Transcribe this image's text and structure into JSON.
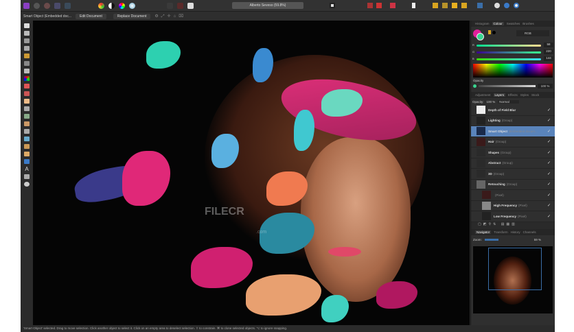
{
  "window": {
    "title": "Alberto Seveso (59.8%)"
  },
  "context_bar": {
    "selection": "Smart Object (Embedded doc...",
    "edit_document": "Edit Document",
    "replace_document": "Replace Document"
  },
  "colour_panel": {
    "tabs": [
      "Histogram",
      "Colour",
      "Swatches",
      "Brushes"
    ],
    "active_tab": "Colour",
    "mode": "RGB",
    "r_label": "R",
    "g_label": "G",
    "b_label": "B",
    "r": "58",
    "g": "220",
    "b": "144",
    "opacity_label": "Opacity",
    "opacity": "100 %",
    "fill_color": "#3ad690",
    "stroke_color": "#e0219a"
  },
  "layers_panel": {
    "tabs": [
      "Adjustment",
      "Layers",
      "Effects",
      "Styles",
      "Stock"
    ],
    "active_tab": "Layers",
    "opacity_label": "Opacity:",
    "opacity": "100 %",
    "blend_mode": "Normal",
    "layers": [
      {
        "name": "Depth of Field Blur",
        "type": "",
        "selected": false
      },
      {
        "name": "Lighting",
        "type": "(Group)",
        "selected": false
      },
      {
        "name": "Smart Object",
        "type": "(Embedded docum...",
        "selected": true
      },
      {
        "name": "Hair",
        "type": "(Group)",
        "selected": false
      },
      {
        "name": "Shapes",
        "type": "(Group)",
        "selected": false
      },
      {
        "name": "Abstract",
        "type": "(Group)",
        "selected": false
      },
      {
        "name": "3D",
        "type": "(Group)",
        "selected": false
      },
      {
        "name": "Retouching",
        "type": "(Group)",
        "selected": false
      },
      {
        "name": "",
        "type": "(Pixel)",
        "selected": false
      },
      {
        "name": "High Frequency",
        "type": "(Pixel)",
        "selected": false
      },
      {
        "name": "Low Frequency",
        "type": "(Pixel)",
        "selected": false
      }
    ]
  },
  "navigator_panel": {
    "tabs": [
      "Navigator",
      "Transform",
      "History",
      "Channels"
    ],
    "active_tab": "Navigator",
    "zoom_label": "Zoom:",
    "zoom": "59 %"
  },
  "watermark": {
    "text": "FILECR",
    "sub": ".com"
  },
  "status_bar": {
    "text": "'Smart Object' selected. Drag to move selection. Click another object to select it. Click on an empty area to deselect selection. ⇧ to constrain. ⌘ to clone selected objects. ⌥ to ignore snapping."
  }
}
